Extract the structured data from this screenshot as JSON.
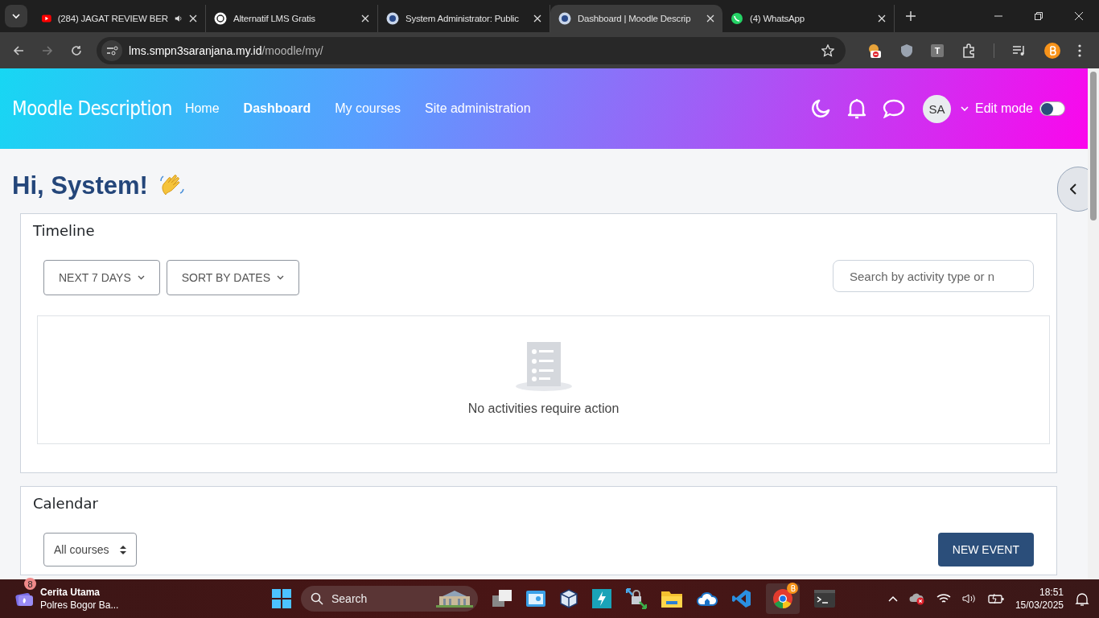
{
  "browser": {
    "tabs": [
      {
        "title": "(284) JAGAT REVIEW BER",
        "kind": "video",
        "audio": true,
        "selected": false
      },
      {
        "title": "Alternatif LMS Gratis",
        "kind": "ai",
        "audio": false,
        "selected": false
      },
      {
        "title": "System Administrator: Public",
        "kind": "site",
        "audio": false,
        "selected": false
      },
      {
        "title": "Dashboard | Moodle Descrip",
        "kind": "site",
        "audio": false,
        "selected": true
      },
      {
        "title": "(4) WhatsApp",
        "kind": "chat",
        "audio": false,
        "selected": false
      }
    ],
    "address": {
      "host": "lms.smpn3saranjana.my.id",
      "path": "/moodle/my/"
    },
    "extension_letter": "T"
  },
  "navbar": {
    "brand": "Moodle Description",
    "links": [
      {
        "label": "Home",
        "selected": false
      },
      {
        "label": "Dashboard",
        "selected": true
      },
      {
        "label": "My courses",
        "selected": false
      },
      {
        "label": "Site administration",
        "selected": false
      }
    ],
    "avatar": "SA",
    "edit_mode": {
      "label": "Edit mode",
      "on": false
    }
  },
  "greeting": "Hi, System!",
  "timeline": {
    "title": "Timeline",
    "filters": [
      "NEXT 7 DAYS",
      "SORT BY DATES"
    ],
    "search": {
      "placeholder": "Search by activity type or n"
    },
    "empty_message": "No activities require action"
  },
  "calendar": {
    "title": "Calendar",
    "course_select": "All courses",
    "new_event": "NEW EVENT"
  },
  "taskbar": {
    "news": {
      "badge": "8",
      "title": "Cerita Utama",
      "subtitle": "Polres Bogor Ba..."
    },
    "search": "Search",
    "time": "18:51",
    "date": "15/03/2025"
  }
}
